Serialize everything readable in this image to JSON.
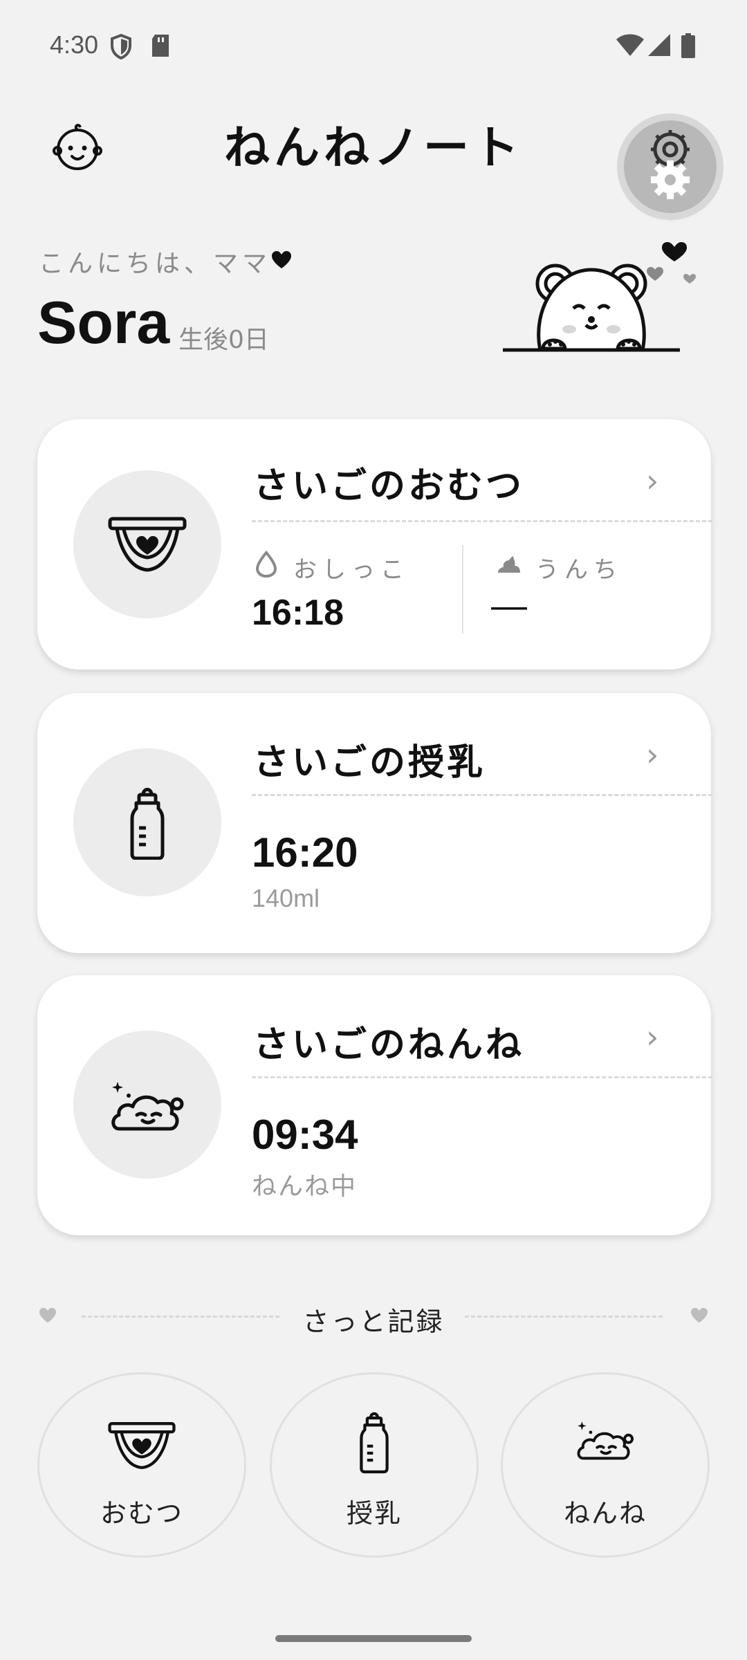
{
  "status_bar": {
    "time": "4:30",
    "icons": [
      "shield-icon",
      "sd-card-icon",
      "wifi-icon",
      "signal-icon",
      "battery-icon"
    ]
  },
  "header": {
    "title": "ねんねノート",
    "left_icon": "baby-face-icon",
    "right_icon": "gear-icon"
  },
  "greeting": {
    "text": "こんにちは、ママ",
    "name": "Sora",
    "age": "生後0日"
  },
  "cards": {
    "diaper": {
      "title": "さいごのおむつ",
      "pee_label": "おしっこ",
      "pee_time": "16:18",
      "poop_label": "うんち",
      "poop_time": "—"
    },
    "feeding": {
      "title": "さいごの授乳",
      "time": "16:20",
      "amount": "140ml"
    },
    "sleep": {
      "title": "さいごのねんね",
      "time": "09:34",
      "status": "ねんね中"
    }
  },
  "quick_record": {
    "title": "さっと記録",
    "buttons": [
      "おむつ",
      "授乳",
      "ねんね"
    ]
  },
  "colors": {
    "background": "#f2f2f2",
    "card": "#ffffff",
    "circle": "#ececec",
    "text": "#111111",
    "muted": "#8a8a8a"
  }
}
